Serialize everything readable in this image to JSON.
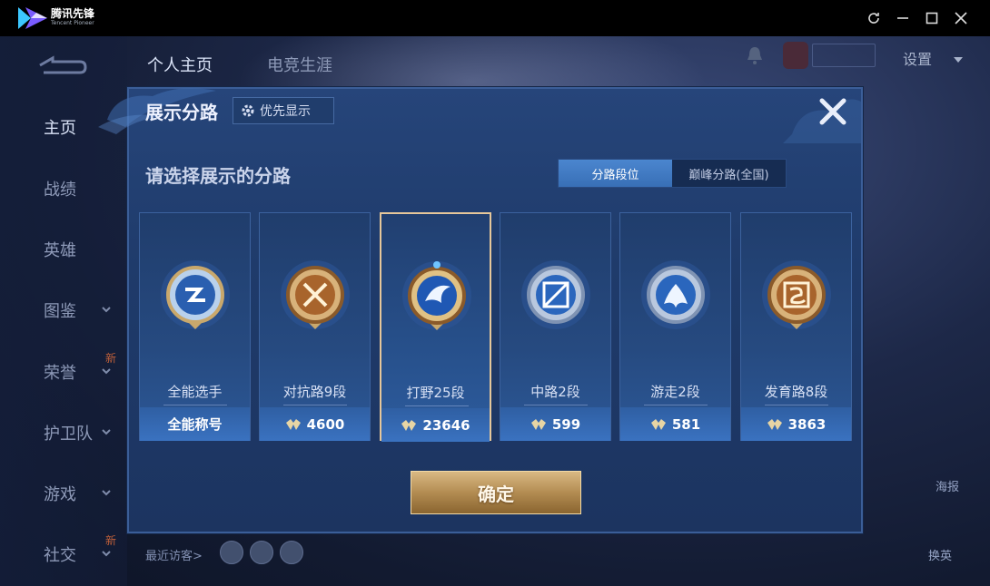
{
  "window": {
    "app_name": "腾讯先锋",
    "app_sub": "Tencent Pioneer"
  },
  "topnav": {
    "tabs": [
      "个人主页",
      "电竞生涯"
    ],
    "settings_label": "设置"
  },
  "sidebar": {
    "items": [
      {
        "label": "主页",
        "active": true
      },
      {
        "label": "战绩"
      },
      {
        "label": "英雄"
      },
      {
        "label": "图鉴",
        "chevron": true
      },
      {
        "label": "荣誉",
        "chevron": true,
        "badge": "新"
      },
      {
        "label": "护卫队",
        "chevron": true
      },
      {
        "label": "游戏",
        "chevron": true
      },
      {
        "label": "社交",
        "chevron": true,
        "badge": "新"
      }
    ]
  },
  "right_panel": {
    "poster_label": "海报",
    "switch_label": "换英"
  },
  "footer": {
    "visitors_label": "最近访客>"
  },
  "dialog": {
    "title": "展示分路",
    "priority_label": "优先显示",
    "subtitle": "请选择展示的分路",
    "segments": [
      "分路段位",
      "巅峰分路(全国)"
    ],
    "active_segment": 0,
    "confirm_label": "确定",
    "cards": [
      {
        "name": "全能选手",
        "value": "全能称号",
        "icon": "all-round-emblem-icon",
        "has_points": false
      },
      {
        "name": "对抗路9段",
        "value": "4600",
        "icon": "clash-lane-emblem-icon",
        "has_points": true
      },
      {
        "name": "打野25段",
        "value": "23646",
        "icon": "jungle-emblem-icon",
        "has_points": true,
        "selected": true
      },
      {
        "name": "中路2段",
        "value": "599",
        "icon": "mid-lane-emblem-icon",
        "has_points": true
      },
      {
        "name": "游走2段",
        "value": "581",
        "icon": "roam-emblem-icon",
        "has_points": true
      },
      {
        "name": "发育路8段",
        "value": "3863",
        "icon": "farm-lane-emblem-icon",
        "has_points": true
      }
    ]
  },
  "colors": {
    "dialog_bg": "#1f3b6b",
    "card_foot": "#3a72c0",
    "selected_border": "#e6c79a",
    "confirm_gold": "#b38c52"
  }
}
